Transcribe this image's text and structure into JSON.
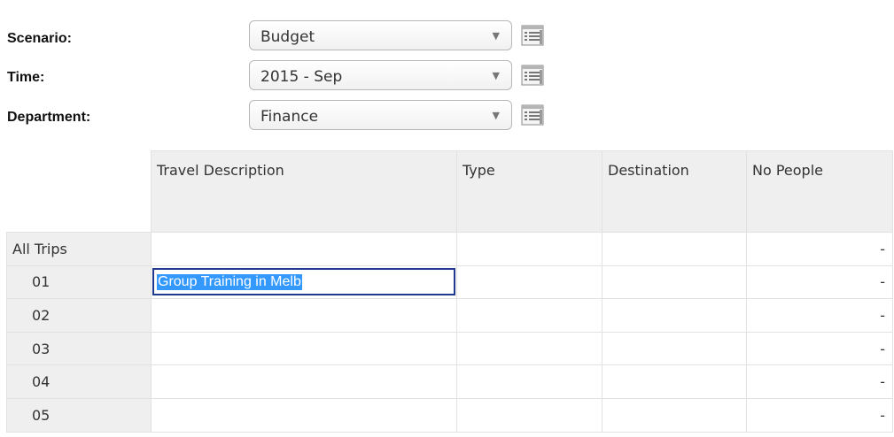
{
  "filters": [
    {
      "label": "Scenario:",
      "value": "Budget",
      "icon": "grid-list-icon"
    },
    {
      "label": "Time:",
      "value": "2015 - Sep",
      "icon": "grid-list-icon"
    },
    {
      "label": "Department:",
      "value": "Finance",
      "icon": "grid-list-icon"
    }
  ],
  "table": {
    "columns": [
      "Travel Description",
      "Type",
      "Destination",
      "No People"
    ],
    "rows": [
      {
        "label": "All Trips",
        "description": "",
        "type": "",
        "destination": "",
        "no_people": "-"
      },
      {
        "label": "01",
        "description": "Group Training in Melb",
        "type": "",
        "destination": "",
        "no_people": "-"
      },
      {
        "label": "02",
        "description": "",
        "type": "",
        "destination": "",
        "no_people": "-"
      },
      {
        "label": "03",
        "description": "",
        "type": "",
        "destination": "",
        "no_people": "-"
      },
      {
        "label": "04",
        "description": "",
        "type": "",
        "destination": "",
        "no_people": "-"
      },
      {
        "label": "05",
        "description": "",
        "type": "",
        "destination": "",
        "no_people": "-"
      }
    ]
  },
  "colors": {
    "header_bg": "#efefef",
    "edit_border": "#1f3a8f",
    "selection": "#3399ff"
  }
}
